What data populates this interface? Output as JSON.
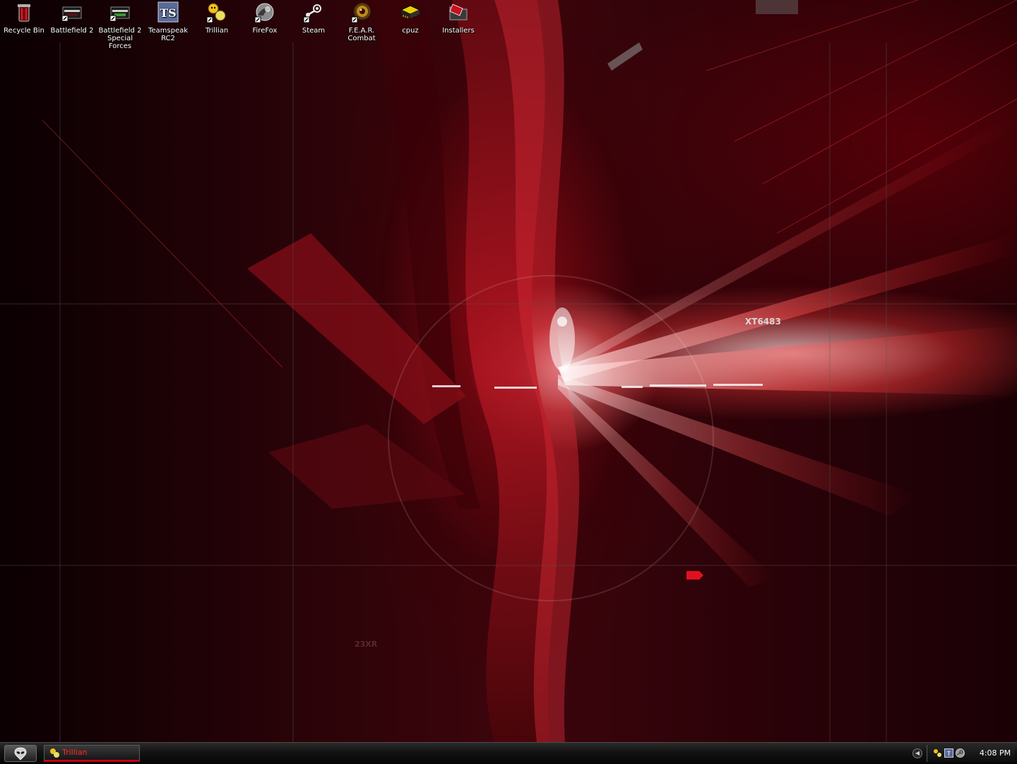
{
  "desktop": {
    "icons": [
      {
        "label": "Recycle Bin",
        "icon": "recycle-bin-icon"
      },
      {
        "label": "Battlefield 2",
        "icon": "battlefield-2-icon"
      },
      {
        "label": "Battlefield 2\nSpecial Forces",
        "icon": "battlefield-2-special-forces-icon"
      },
      {
        "label": "Teamspeak\nRC2",
        "icon": "teamspeak-icon"
      },
      {
        "label": "Trillian",
        "icon": "trillian-icon"
      },
      {
        "label": "FireFox",
        "icon": "firefox-icon"
      },
      {
        "label": "Steam",
        "icon": "steam-icon"
      },
      {
        "label": "F.E.A.R.\nCombat",
        "icon": "fear-combat-icon"
      },
      {
        "label": "cpuz",
        "icon": "cpuz-icon"
      },
      {
        "label": "Installers",
        "icon": "installers-folder-icon"
      }
    ],
    "wallpaper": {
      "text_a": "XT6483",
      "text_b": "23XR"
    }
  },
  "taskbar": {
    "start_icon": "alien-head-icon",
    "tasks": [
      {
        "label": "Trillian",
        "icon": "trillian-icon"
      }
    ],
    "tray": {
      "chevron_icon": "chevron-left-icon",
      "icons": [
        "trillian-tray-icon",
        "teamspeak-tray-icon",
        "steam-tray-icon"
      ],
      "clock": "4:08 PM"
    }
  },
  "colors": {
    "accent": "#c40012",
    "task_text": "#ff2b2b",
    "taskbar_bg": "#121212"
  }
}
